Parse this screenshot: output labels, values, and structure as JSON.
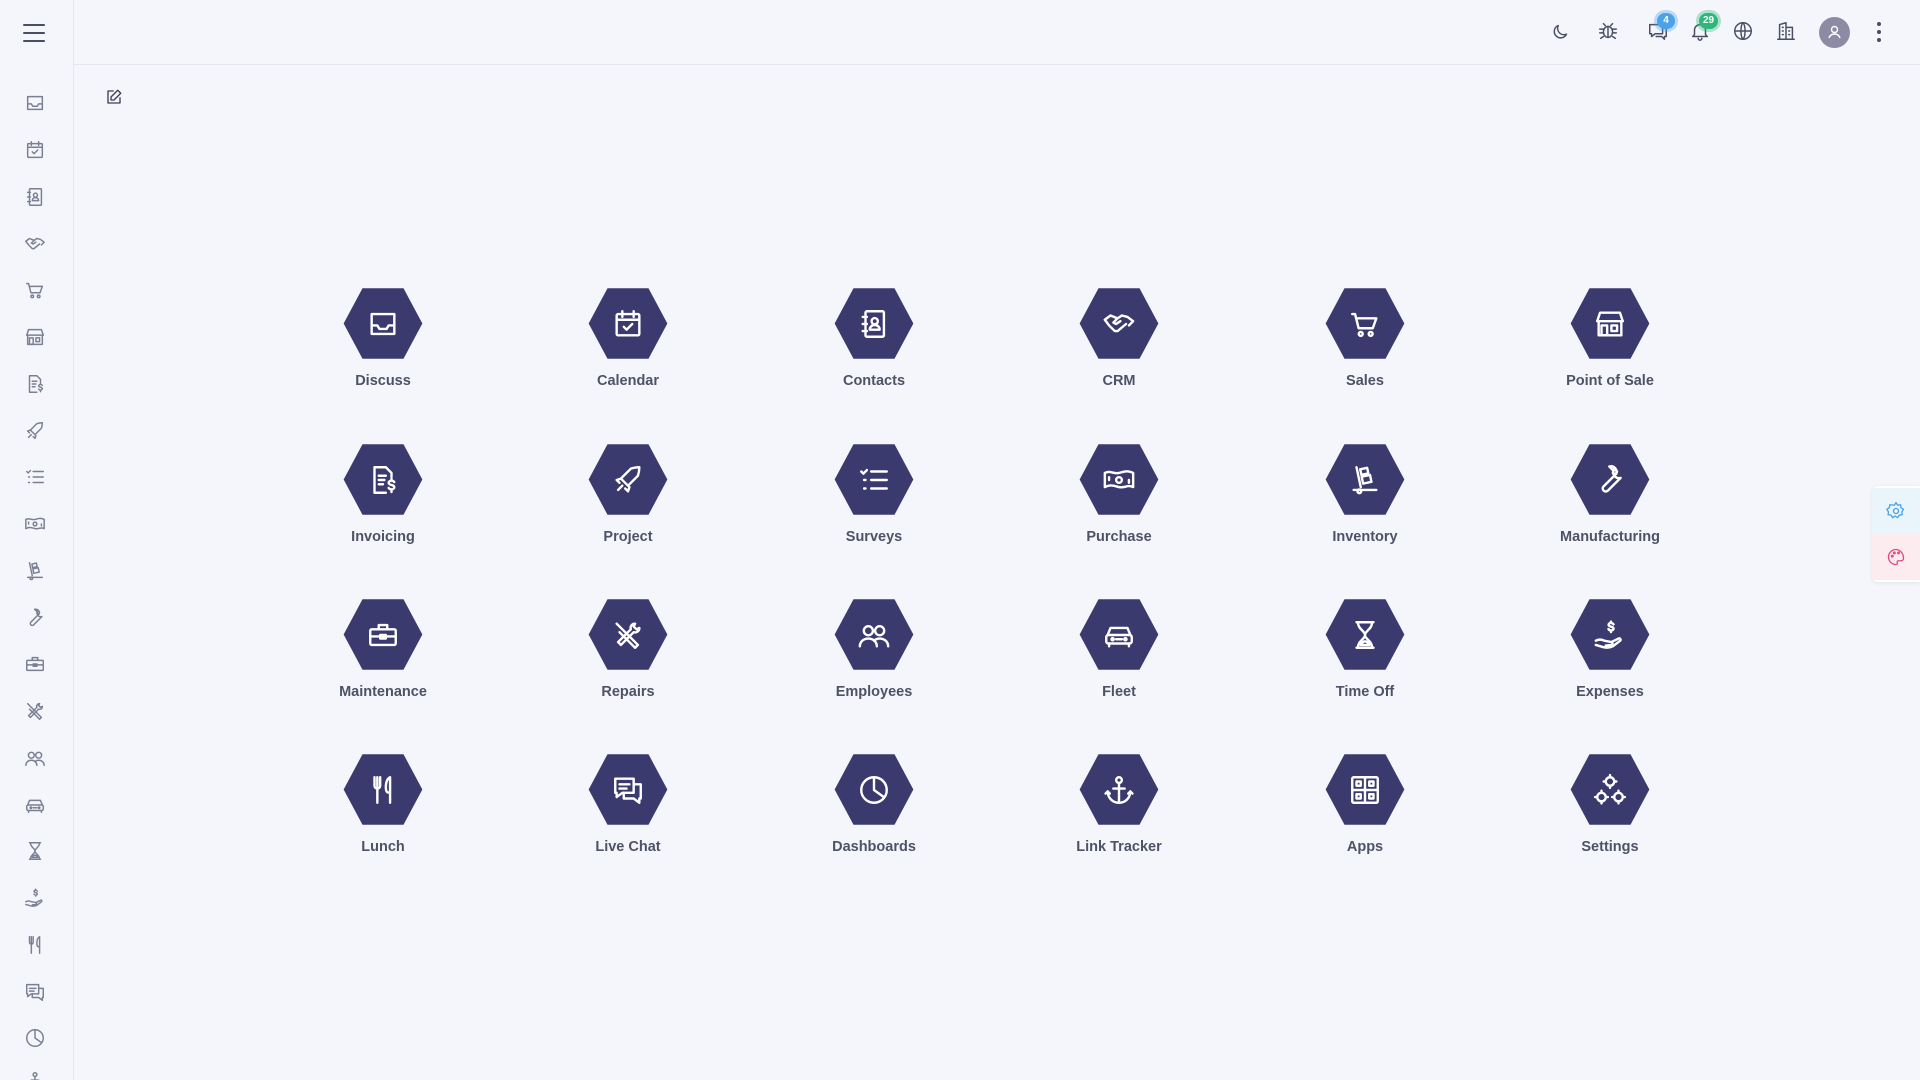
{
  "topbar": {
    "messages_badge": "4",
    "notifications_badge": "29"
  },
  "apps": [
    {
      "label": "Discuss",
      "icon": "inbox-icon"
    },
    {
      "label": "Calendar",
      "icon": "calendar-icon"
    },
    {
      "label": "Contacts",
      "icon": "contacts-icon"
    },
    {
      "label": "CRM",
      "icon": "handshake-icon"
    },
    {
      "label": "Sales",
      "icon": "cart-icon"
    },
    {
      "label": "Point of Sale",
      "icon": "store-icon"
    },
    {
      "label": "Invoicing",
      "icon": "invoice-icon"
    },
    {
      "label": "Project",
      "icon": "rocket-icon"
    },
    {
      "label": "Surveys",
      "icon": "checklist-icon"
    },
    {
      "label": "Purchase",
      "icon": "banknote-icon"
    },
    {
      "label": "Inventory",
      "icon": "dolly-icon"
    },
    {
      "label": "Manufacturing",
      "icon": "wrench-icon"
    },
    {
      "label": "Maintenance",
      "icon": "toolbox-icon"
    },
    {
      "label": "Repairs",
      "icon": "tools-icon"
    },
    {
      "label": "Employees",
      "icon": "users-icon"
    },
    {
      "label": "Fleet",
      "icon": "car-icon"
    },
    {
      "label": "Time Off",
      "icon": "hourglass-icon"
    },
    {
      "label": "Expenses",
      "icon": "hand-dollar-icon"
    },
    {
      "label": "Lunch",
      "icon": "utensils-icon"
    },
    {
      "label": "Live Chat",
      "icon": "chat-icon"
    },
    {
      "label": "Dashboards",
      "icon": "pie-chart-icon"
    },
    {
      "label": "Link Tracker",
      "icon": "anchor-icon"
    },
    {
      "label": "Apps",
      "icon": "grid-icon"
    },
    {
      "label": "Settings",
      "icon": "gears-icon"
    }
  ],
  "colors": {
    "hex_tile": "#3b3a6f",
    "background": "#f4f6fb",
    "badge_blue": "#4aa3e8",
    "badge_green": "#2fb779"
  }
}
